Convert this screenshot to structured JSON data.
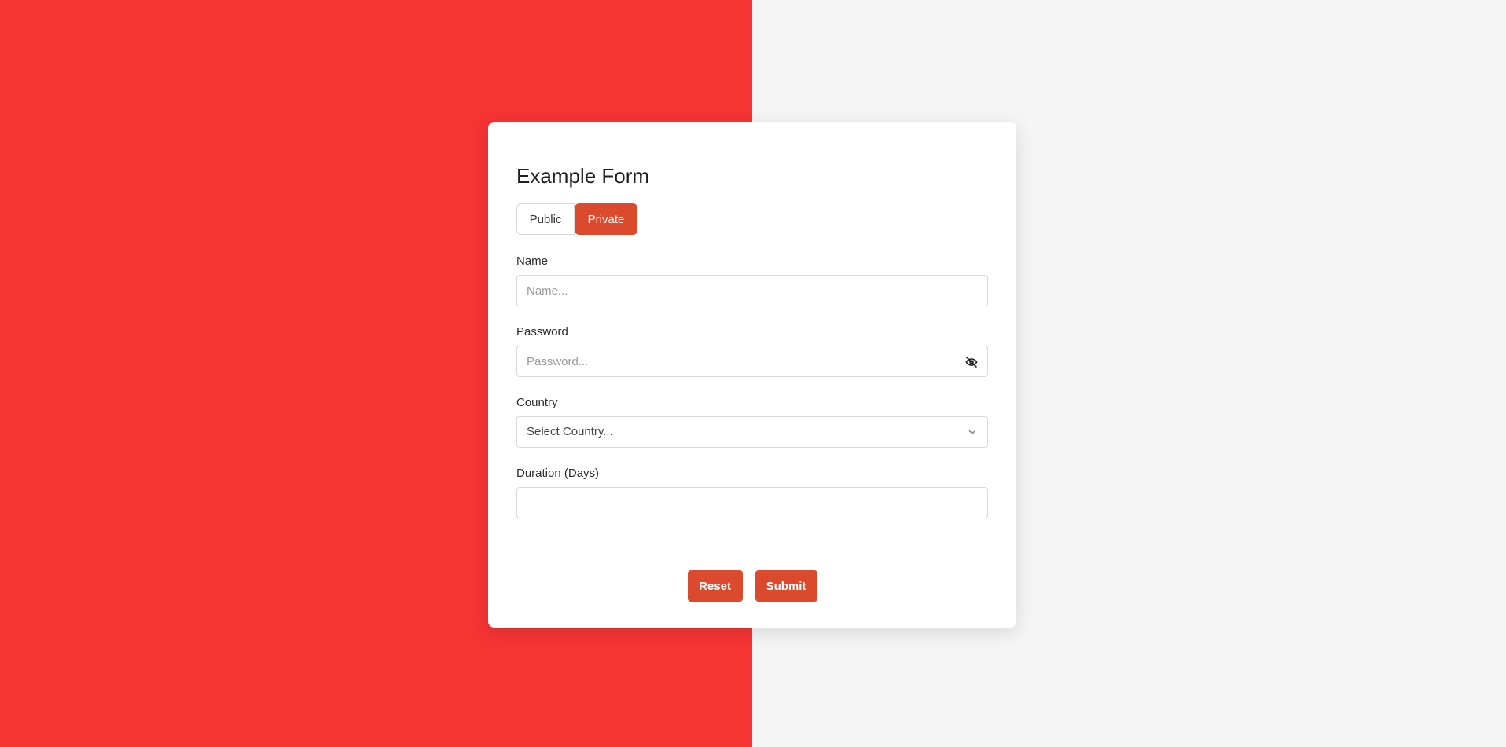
{
  "form": {
    "title": "Example Form",
    "visibility_toggle": {
      "options": [
        "Public",
        "Private"
      ],
      "selected": "Private"
    },
    "fields": {
      "name": {
        "label": "Name",
        "placeholder": "Name...",
        "value": ""
      },
      "password": {
        "label": "Password",
        "placeholder": "Password...",
        "value": "",
        "icon": "eye-off-icon"
      },
      "country": {
        "label": "Country",
        "selected_text": "Select Country...",
        "icon": "chevron-down-icon"
      },
      "duration": {
        "label": "Duration (Days)",
        "value": ""
      }
    },
    "actions": {
      "reset_label": "Reset",
      "submit_label": "Submit"
    }
  },
  "colors": {
    "left_background": "#f53434",
    "right_background": "#f5f5f5",
    "accent": "#dc4a2e",
    "card": "#ffffff"
  }
}
